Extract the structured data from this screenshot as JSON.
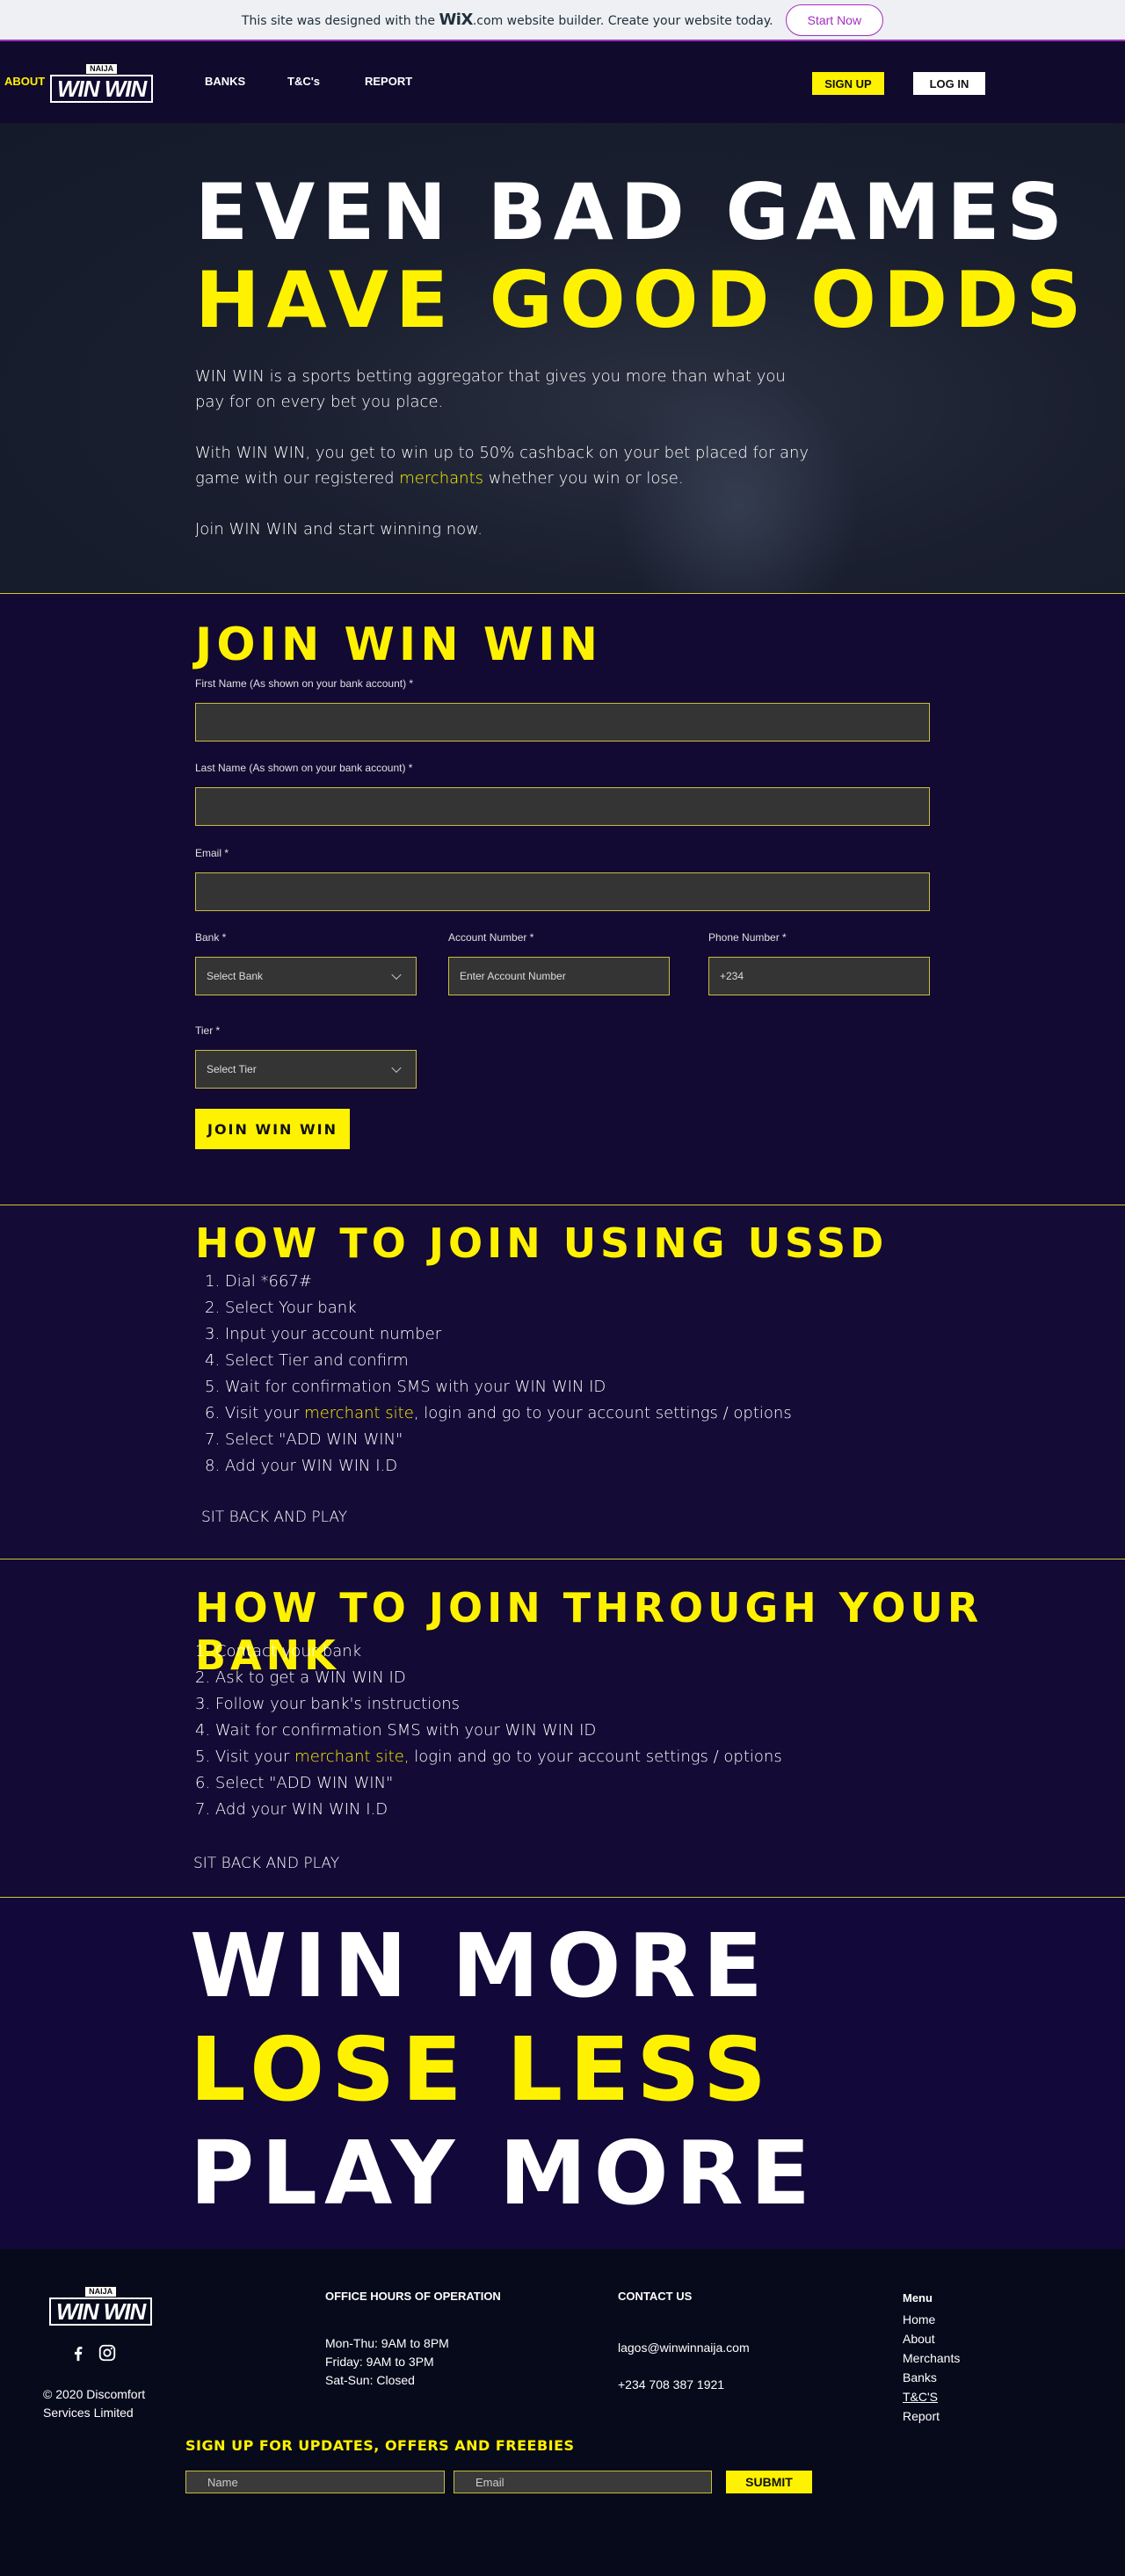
{
  "banner": {
    "text_before": "This site was designed with the ",
    "brand": "WiX",
    "text_after": ".com website builder. Create your website today.",
    "cta": "Start Now"
  },
  "header": {
    "nav": [
      "ABOUT",
      "BANKS",
      "T&C's",
      "REPORT"
    ],
    "logo_top": "NAIJA",
    "logo_main": "WIN WIN",
    "signup": "SIGN UP",
    "login": "LOG IN"
  },
  "hero": {
    "line1": "EVEN BAD GAMES",
    "line2": "HAVE GOOD ODDS",
    "p1": "WIN WIN is a sports betting aggregator that gives you more than what you pay for on every bet you place.",
    "p2_before": "With WIN WIN, you get to win up to 50% cashback on your bet placed for any game with our registered ",
    "p2_link": "merchants",
    "p2_after": " whether you win or lose.",
    "p3": "Join WIN WIN and start winning now."
  },
  "join": {
    "title": "JOIN WIN WIN",
    "first_name_label": "First Name (As shown on your bank account) *",
    "last_name_label": "Last Name (As shown on your bank account) *",
    "email_label": "Email *",
    "bank_label": "Bank *",
    "bank_value": "Select Bank",
    "account_label": "Account Number *",
    "account_placeholder": "Enter Account Number",
    "phone_label": "Phone Number *",
    "phone_value": "+234",
    "tier_label": "Tier *",
    "tier_value": "Select Tier",
    "submit": "JOIN WIN WIN"
  },
  "ussd": {
    "title": "HOW TO JOIN USING USSD",
    "steps": [
      "1. Dial *667#",
      "2. Select Your bank",
      "3. Input your account number",
      "4. Select Tier and confirm",
      "5. Wait for confirmation SMS with your WIN WIN ID",
      "7. Select \"ADD WIN WIN\"",
      "8. Add your WIN WIN I.D"
    ],
    "step6_before": "6. Visit your ",
    "step6_link": "merchant site",
    "step6_after": ", login and go to your account settings / options",
    "closing": "SIT BACK AND PLAY"
  },
  "bank": {
    "title": "HOW TO JOIN THROUGH YOUR BANK",
    "steps": [
      "1. Contact your bank",
      "2. Ask to get a WIN WIN ID",
      "3. Follow your bank's instructions",
      "4. Wait for confirmation SMS with your WIN WIN ID",
      "6. Select \"ADD WIN WIN\"",
      "7. Add your WIN WIN I.D"
    ],
    "step5_before": "5. Visit your ",
    "step5_link": "merchant site,",
    "step5_after": " login and go to your account settings / options",
    "closing": "SIT BACK AND PLAY"
  },
  "slogan": {
    "line1": "WIN MORE",
    "line2": "LOSE LESS",
    "line3": "PLAY MORE"
  },
  "footer": {
    "logo_top": "NAIJA",
    "logo_main": "WIN WIN",
    "copyright_1": "© 2020 Discomfort",
    "copyright_2": "Services Limited",
    "hours_title": "OFFICE HOURS OF OPERATION",
    "hours": [
      "Mon-Thu: 9AM to 8PM",
      "Friday: 9AM to 3PM",
      "Sat-Sun: Closed"
    ],
    "contact_title": "CONTACT US",
    "email": "lagos@winwinnaija.com",
    "phone": "+234 708 387 1921",
    "menu_title": "Menu",
    "menu": [
      "Home",
      "About",
      "Merchants",
      "Banks",
      "T&C'S",
      "Report"
    ],
    "newsletter_title": "SIGN UP FOR UPDATES, OFFERS AND FREEBIES",
    "name_placeholder": "Name",
    "email_placeholder": "Email",
    "submit": "SUBMIT"
  },
  "colors": {
    "accent": "#fff200",
    "banner_purple": "#a32fbd",
    "background": "#0d0b2b"
  }
}
